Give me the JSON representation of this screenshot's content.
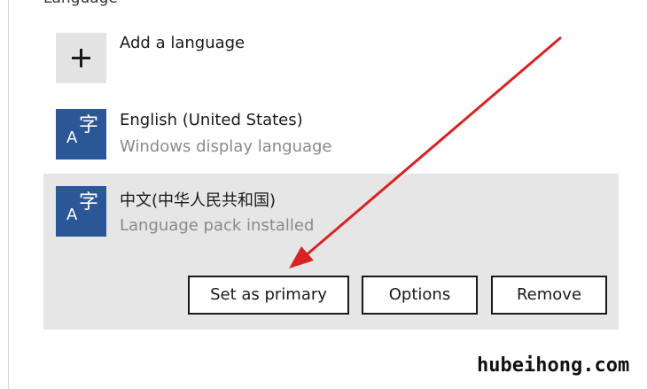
{
  "section": {
    "header": "Language"
  },
  "add_language": {
    "label": "Add a language",
    "icon": "plus-icon"
  },
  "languages": [
    {
      "name": "English (United States)",
      "status": "Windows display language",
      "icon": "language-icon",
      "tile_glyph_a": "A",
      "tile_glyph_char": "字"
    },
    {
      "name": "中文(中华人民共和国)",
      "status": "Language pack installed",
      "icon": "language-icon",
      "tile_glyph_a": "A",
      "tile_glyph_char": "字"
    }
  ],
  "actions": {
    "set_primary": "Set as primary",
    "options": "Options",
    "remove": "Remove"
  },
  "colors": {
    "tile_blue": "#2b5797",
    "selected_row": "#e6e6e6",
    "arrow_red": "#d62424"
  },
  "watermark": "hubeihong.com"
}
